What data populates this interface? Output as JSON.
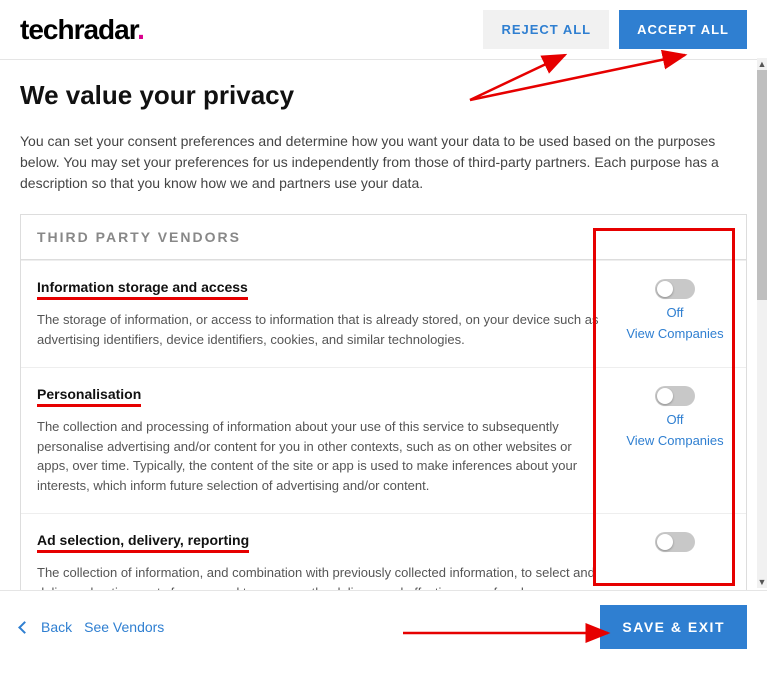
{
  "logo": {
    "text": "techradar"
  },
  "header": {
    "reject": "REJECT ALL",
    "accept": "ACCEPT ALL"
  },
  "title": "We value your privacy",
  "intro": "You can set your consent preferences and determine how you want your data to be used based on the purposes below. You may set your preferences for us independently from those of third-party partners. Each purpose has a description so that you know how we and partners use your data.",
  "panel": {
    "header": "THIRD PARTY VENDORS"
  },
  "shared": {
    "off": "Off",
    "view": "View Companies"
  },
  "cats": [
    {
      "title": "Information storage and access",
      "desc": "The storage of information, or access to information that is already stored, on your device such as advertising identifiers, device identifiers, cookies, and similar technologies."
    },
    {
      "title": "Personalisation",
      "desc": "The collection and processing of information about your use of this service to subsequently personalise advertising and/or content for you in other contexts, such as on other websites or apps, over time. Typically, the content of the site or app is used to make inferences about your interests, which inform future selection of advertising and/or content."
    },
    {
      "title": "Ad selection, delivery, reporting",
      "desc": "The collection of information, and combination with previously collected information, to select and deliver advertisements for you, and to measure the delivery and effectiveness of such advertisements. This includes using previously collected information about your"
    }
  ],
  "footer": {
    "back": "Back",
    "vendors": "See Vendors",
    "save": "SAVE & EXIT"
  }
}
